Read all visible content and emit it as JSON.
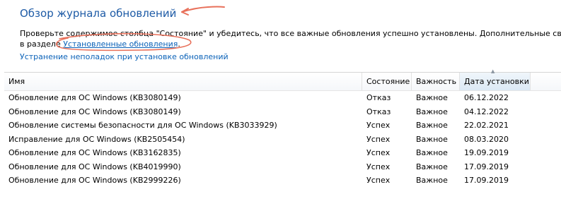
{
  "header": {
    "title": "Обзор журнала обновлений",
    "description_line1": "Проверьте содержимое столбца \"Состояние\" и убедитесь, что все важные обновления успешно установлены. Дополнительные сведения",
    "description_prefix": "в разделе ",
    "installed_updates_link": "Установленные обновления",
    "description_suffix": ".",
    "troubleshoot_link": "Устранение неполадок при установке обновлений"
  },
  "table": {
    "columns": [
      "Имя",
      "Состояние",
      "Важность",
      "Дата установки"
    ],
    "sort_icon": "sort-ascending-icon",
    "rows": [
      {
        "name": "Обновление для ОС Windows (KB3080149)",
        "status": "Отказ",
        "importance": "Важное",
        "date": "06.12.2022"
      },
      {
        "name": "Обновление для ОС Windows (KB3080149)",
        "status": "Отказ",
        "importance": "Важное",
        "date": "04.12.2022"
      },
      {
        "name": "Обновление системы безопасности для ОС Windows (KB3033929)",
        "status": "Успех",
        "importance": "Важное",
        "date": "22.02.2021"
      },
      {
        "name": "Исправление для ОС Windows (KB2505454)",
        "status": "Успех",
        "importance": "Важное",
        "date": "08.03.2020"
      },
      {
        "name": "Обновление для ОС Windows (KB3162835)",
        "status": "Успех",
        "importance": "Важное",
        "date": "19.09.2019"
      },
      {
        "name": "Обновление для ОС Windows (KB4019990)",
        "status": "Успех",
        "importance": "Важное",
        "date": "17.09.2019"
      },
      {
        "name": "Обновление для ОС Windows (KB2999226)",
        "status": "Успех",
        "importance": "Важное",
        "date": "17.09.2019"
      }
    ]
  },
  "colors": {
    "title": "#1e5ba6",
    "link": "#0b62b8",
    "annotation": "#e8705a"
  }
}
